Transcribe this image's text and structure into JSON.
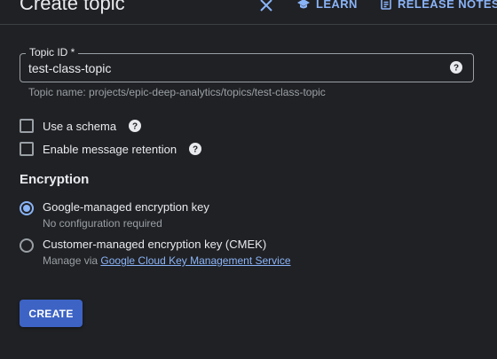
{
  "header": {
    "title": "Create topic",
    "learn_label": "LEARN",
    "release_notes_label": "RELEASE NOTES"
  },
  "topic_id": {
    "label": "Topic ID *",
    "value": "test-class-topic",
    "hint": "Topic name: projects/epic-deep-analytics/topics/test-class-topic"
  },
  "options": {
    "use_schema_label": "Use a schema",
    "use_schema_checked": false,
    "retention_label": "Enable message retention",
    "retention_checked": false
  },
  "encryption": {
    "title": "Encryption",
    "google_label": "Google-managed encryption key",
    "google_sub": "No configuration required",
    "google_selected": true,
    "cmek_label": "Customer-managed encryption key (CMEK)",
    "cmek_sub_prefix": "Manage via",
    "cmek_link": "Google Cloud Key Management Service",
    "cmek_selected": false
  },
  "actions": {
    "create_label": "CREATE"
  },
  "colors": {
    "background": "#202124",
    "accent": "#8ab4f8",
    "primary_button": "#3d63c5"
  }
}
